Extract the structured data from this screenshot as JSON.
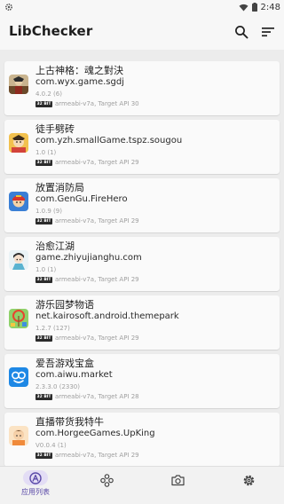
{
  "status_bar": {
    "time": "2:48"
  },
  "app_bar": {
    "title": "LibChecker",
    "search_icon": "search-icon",
    "sort_icon": "sort-icon"
  },
  "apps": [
    {
      "name": "上古神格：魂之對決",
      "package": "com.wyx.game.sgdj",
      "version": "4.0.2 (6)",
      "abi_badge": "32 BIT",
      "abi_info": "armeabi-v7a, Target API 30"
    },
    {
      "name": "徒手劈砖",
      "package": "com.yzh.smallGame.tspz.sougou",
      "version": "1.0 (1)",
      "abi_badge": "32 BIT",
      "abi_info": "armeabi-v7a, Target API 29"
    },
    {
      "name": "放置消防局",
      "package": "com.GenGu.FireHero",
      "version": "1.0.9 (9)",
      "abi_badge": "32 BIT",
      "abi_info": "armeabi-v7a, Target API 29"
    },
    {
      "name": "治愈江湖",
      "package": "game.zhiyujianghu.com",
      "version": "1.0 (1)",
      "abi_badge": "32 BIT",
      "abi_info": "armeabi-v7a, Target API 29"
    },
    {
      "name": "游乐园梦物语",
      "package": "net.kairosoft.android.themepark",
      "version": "1.2.7 (127)",
      "abi_badge": "32 BIT",
      "abi_info": "armeabi-v7a, Target API 29"
    },
    {
      "name": "爱吾游戏宝盒",
      "package": "com.aiwu.market",
      "version": "2.3.3.0 (2330)",
      "abi_badge": "32 BIT",
      "abi_info": "armeabi-v7a, Target API 28"
    },
    {
      "name": "直播带货我特牛",
      "package": "com.HorgeeGames.UpKing",
      "version": "V0.0.4 (1)",
      "abi_badge": "32 BIT",
      "abi_info": "armeabi-v7a, Target API 29"
    }
  ],
  "bottom_nav": {
    "items": [
      {
        "label": "应用列表",
        "icon": "app-list-icon",
        "active": true
      },
      {
        "label": "",
        "icon": "snapshot-icon",
        "active": false
      },
      {
        "label": "",
        "icon": "camera-icon",
        "active": false
      },
      {
        "label": "",
        "icon": "settings-icon",
        "active": false
      }
    ]
  },
  "colors": {
    "accent": "#5b4aa8",
    "accent_container": "#e3ddf5",
    "background": "#ececec",
    "card": "#fafafa"
  }
}
